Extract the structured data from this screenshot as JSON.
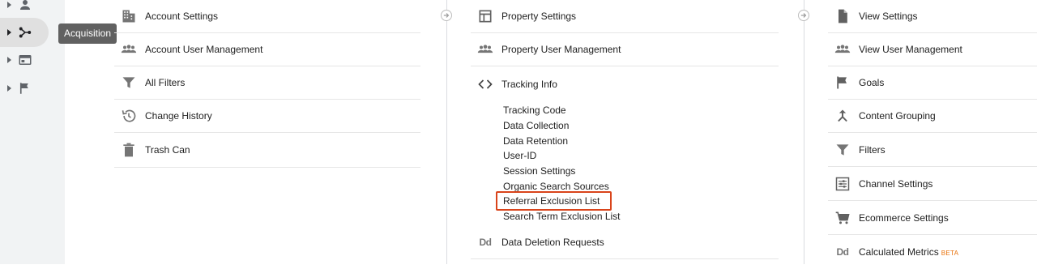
{
  "rail": {
    "items": [
      {
        "icon": "person-icon"
      },
      {
        "icon": "acquisition-icon"
      },
      {
        "icon": "browser-window-icon"
      },
      {
        "icon": "flag-icon"
      }
    ],
    "tooltip": "Acquisition"
  },
  "account": {
    "items": [
      {
        "label": "Account Settings",
        "icon": "building-icon"
      },
      {
        "label": "Account User Management",
        "icon": "people-icon"
      },
      {
        "label": "All Filters",
        "icon": "filter-icon"
      },
      {
        "label": "Change History",
        "icon": "history-icon"
      },
      {
        "label": "Trash Can",
        "icon": "trash-icon"
      }
    ]
  },
  "property": {
    "items": [
      {
        "label": "Property Settings",
        "icon": "layout-icon"
      },
      {
        "label": "Property User Management",
        "icon": "people-icon"
      },
      {
        "label": "Tracking Info",
        "icon": "code-icon"
      }
    ],
    "tracking_subitems": [
      "Tracking Code",
      "Data Collection",
      "Data Retention",
      "User-ID",
      "Session Settings",
      "Organic Search Sources",
      "Referral Exclusion List",
      "Search Term Exclusion List"
    ],
    "data_deletion": {
      "label": "Data Deletion Requests",
      "icon_text": "Dd"
    },
    "highlighted_item": "Referral Exclusion List",
    "highlight_color": "#d9441b"
  },
  "view": {
    "items": [
      {
        "label": "View Settings",
        "icon": "document-icon"
      },
      {
        "label": "View User Management",
        "icon": "people-icon"
      },
      {
        "label": "Goals",
        "icon": "flag-icon"
      },
      {
        "label": "Content Grouping",
        "icon": "merge-icon"
      },
      {
        "label": "Filters",
        "icon": "filter-icon"
      },
      {
        "label": "Channel Settings",
        "icon": "channel-icon"
      },
      {
        "label": "Ecommerce Settings",
        "icon": "cart-icon"
      }
    ],
    "calculated_metrics": {
      "label": "Calculated Metrics",
      "badge": "BETA",
      "icon_text": "Dd"
    }
  }
}
